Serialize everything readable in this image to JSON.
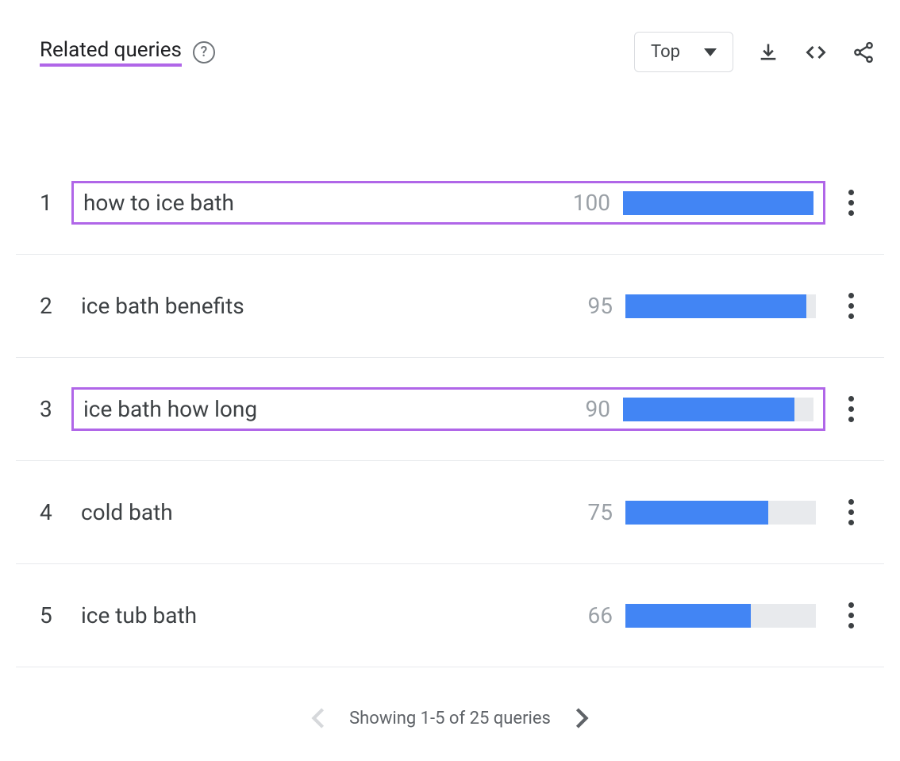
{
  "header": {
    "title": "Related queries",
    "help_glyph": "?",
    "dropdown": {
      "selected": "Top"
    }
  },
  "queries": [
    {
      "rank": "1",
      "label": "how to ice bath",
      "value": "100",
      "bar": 100,
      "highlighted": true
    },
    {
      "rank": "2",
      "label": "ice bath benefits",
      "value": "95",
      "bar": 95,
      "highlighted": false
    },
    {
      "rank": "3",
      "label": "ice bath how long",
      "value": "90",
      "bar": 90,
      "highlighted": true
    },
    {
      "rank": "4",
      "label": "cold bath",
      "value": "75",
      "bar": 75,
      "highlighted": false
    },
    {
      "rank": "5",
      "label": "ice tub bath",
      "value": "66",
      "bar": 66,
      "highlighted": false
    }
  ],
  "pagination": {
    "text": "Showing 1-5 of 25 queries"
  }
}
